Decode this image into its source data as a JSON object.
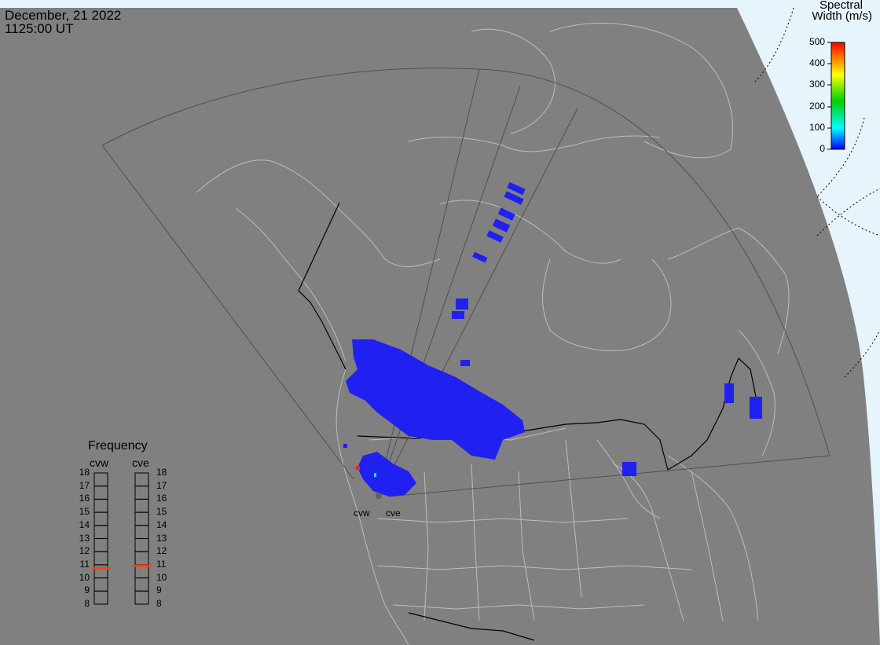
{
  "header": {
    "date": "December, 21 2022",
    "time": "1125:00 UT"
  },
  "colorbar": {
    "title_line1": "Spectral",
    "title_line2": "Width (m/s)",
    "ticks": [
      "500",
      "400",
      "300",
      "200",
      "100",
      "0"
    ],
    "colors": [
      "#ff0000",
      "#ffff00",
      "#00d000",
      "#00ffff",
      "#0000ff"
    ]
  },
  "frequency_panel": {
    "title": "Frequency",
    "radars": [
      {
        "name": "cvw",
        "value_mhz": 10.7
      },
      {
        "name": "cve",
        "value_mhz": 10.9
      }
    ],
    "scale": [
      "18",
      "17",
      "16",
      "15",
      "14",
      "13",
      "12",
      "11",
      "10",
      "9",
      "8"
    ],
    "marker_color": "#ff4000"
  },
  "sites": {
    "west": "cvw",
    "east": "cve"
  },
  "colors": {
    "background": "#808080",
    "space": "#e6f4fc",
    "echo": "#2020f0",
    "coast": "#b8b8b8",
    "border": "#000000",
    "fov": "#505050"
  }
}
